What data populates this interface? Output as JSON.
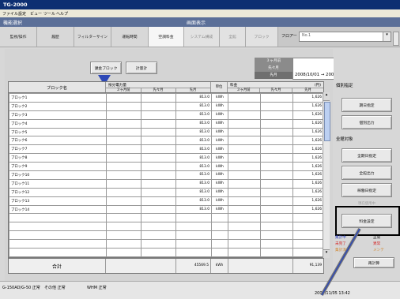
{
  "app": {
    "title": "TG-2000"
  },
  "menu": [
    "ファイル",
    "設定",
    "ビュー",
    "ツール",
    "ヘルプ"
  ],
  "bands": {
    "function_select": "機能選択",
    "screen_display": "画面表示"
  },
  "function_tabs": [
    "監視/操作",
    "履歴",
    "フィルターサイン",
    "運転時間",
    "空調料金"
  ],
  "display_tabs": [
    "システム構成",
    "全館",
    "ブロック"
  ],
  "floor": {
    "label": "フロアー",
    "value": "No.1"
  },
  "toolbar": {
    "block_button": "課金ブロック",
    "meter_button": "計量計"
  },
  "period": {
    "labels": [
      "３ヶ月前",
      "先々月",
      "先月"
    ],
    "range_text": "2008/10/01 → 2008/10/31"
  },
  "table": {
    "headers": {
      "block": "ブロック名",
      "power": "按分電力量",
      "charge": "料金",
      "unit": "単位",
      "yen": "(円)",
      "sub": [
        "３ヶ月前",
        "先々月",
        "先月",
        "３ヶ月前",
        "先々月",
        "先月"
      ]
    },
    "rows": [
      {
        "name": "ブロック1",
        "kwh": "813.0",
        "unit": "kWh",
        "yen": "1,626"
      },
      {
        "name": "ブロック2",
        "kwh": "813.0",
        "unit": "kWh",
        "yen": "1,626"
      },
      {
        "name": "ブロック3",
        "kwh": "813.0",
        "unit": "kWh",
        "yen": "1,626"
      },
      {
        "name": "ブロック4",
        "kwh": "813.0",
        "unit": "kWh",
        "yen": "1,626"
      },
      {
        "name": "ブロック5",
        "kwh": "813.0",
        "unit": "kWh",
        "yen": "1,626"
      },
      {
        "name": "ブロック6",
        "kwh": "813.0",
        "unit": "kWh",
        "yen": "1,626"
      },
      {
        "name": "ブロック7",
        "kwh": "813.0",
        "unit": "kWh",
        "yen": "1,626"
      },
      {
        "name": "ブロック8",
        "kwh": "813.0",
        "unit": "kWh",
        "yen": "1,626"
      },
      {
        "name": "ブロック9",
        "kwh": "813.0",
        "unit": "kWh",
        "yen": "1,626"
      },
      {
        "name": "ブロック10",
        "kwh": "813.0",
        "unit": "kWh",
        "yen": "1,626"
      },
      {
        "name": "ブロック11",
        "kwh": "813.0",
        "unit": "kWh",
        "yen": "1,626"
      },
      {
        "name": "ブロック12",
        "kwh": "813.0",
        "unit": "kWh",
        "yen": "1,626"
      },
      {
        "name": "ブロック13",
        "kwh": "813.0",
        "unit": "kWh",
        "yen": "1,626"
      },
      {
        "name": "ブロック14",
        "kwh": "813.0",
        "unit": "kWh",
        "yen": "1,626"
      }
    ],
    "total": {
      "label": "合計",
      "kwh": "45569.5",
      "unit": "kWh",
      "yen": "91,139"
    }
  },
  "right_panel": {
    "individual_title": "個別指定",
    "individual_buttons": [
      "期日指定",
      "個別出力"
    ],
    "all_title": "全館対象",
    "all_buttons": [
      "全期日指定",
      "全館出力",
      "稼働日指定"
    ],
    "faded_button": "現在使用中",
    "rate_button": "料金設定",
    "legend": [
      {
        "label": "集計中",
        "value": "正常"
      },
      {
        "label": "未完了",
        "value": "異常"
      },
      {
        "label": "集計済",
        "value": "メンテ"
      }
    ],
    "recalc_button": "再計算"
  },
  "status": {
    "items": [
      "G-150AD/G-50 正常",
      "その他 正常",
      "WHM 正常"
    ],
    "datetime": "2008/11/05  13:42"
  },
  "colors": {
    "title_bg": "#0d2f72",
    "band_bg": "#5b6f98",
    "legend_blue": "#2d3fc0",
    "legend_red": "#d51c1c",
    "legend_orange": "#d1842a",
    "arrow": "#2d48b7"
  }
}
